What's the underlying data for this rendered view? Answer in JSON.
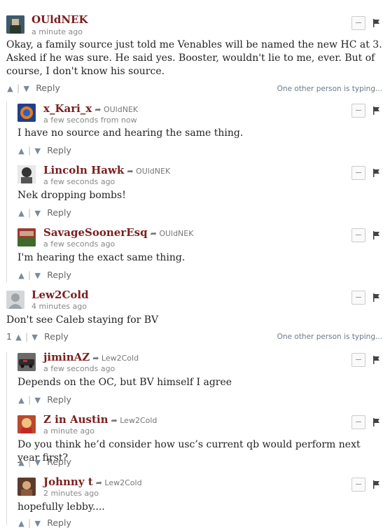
{
  "typing_text": "One other person is typing...",
  "reply_label": "Reply",
  "comments": [
    {
      "user": "OUldNEK",
      "reply_to": "",
      "time": "a minute ago",
      "text": "Okay, a family source just told me Venables will be named the new HC at 3. Asked if he was sure. He said yes. Booster, wouldn't lie to me, ever. But of course, I don't know his source.",
      "votes": "",
      "typing": true
    },
    {
      "user": "x_Kari_x",
      "reply_to": "OUldNEK",
      "time": "a few seconds from now",
      "text": "I have no source and hearing the same thing.",
      "votes": "",
      "typing": false
    },
    {
      "user": "Lincoln Hawk",
      "reply_to": "OUldNEK",
      "time": "a few seconds ago",
      "text": "Nek dropping bombs!",
      "votes": "",
      "typing": false
    },
    {
      "user": "SavageSoonerEsq",
      "reply_to": "OUldNEK",
      "time": "a few seconds ago",
      "text": "I'm hearing the exact same thing.",
      "votes": "",
      "typing": false
    },
    {
      "user": "Lew2Cold",
      "reply_to": "",
      "time": "4 minutes ago",
      "text": "Don't see Caleb staying for BV",
      "votes": "1",
      "typing": true
    },
    {
      "user": "jiminAZ",
      "reply_to": "Lew2Cold",
      "time": "a few seconds ago",
      "text": "Depends on the OC, but BV himself I agree",
      "votes": "",
      "typing": false
    },
    {
      "user": "Z in Austin",
      "reply_to": "Lew2Cold",
      "time": "a minute ago",
      "text": "Do you think he’d consider how usc’s current qb would perform next year first?",
      "votes": "",
      "typing": false
    },
    {
      "user": "Johnny t",
      "reply_to": "Lew2Cold",
      "time": "2 minutes ago",
      "text": "hopefully lebby....",
      "votes": "",
      "typing": false
    }
  ]
}
